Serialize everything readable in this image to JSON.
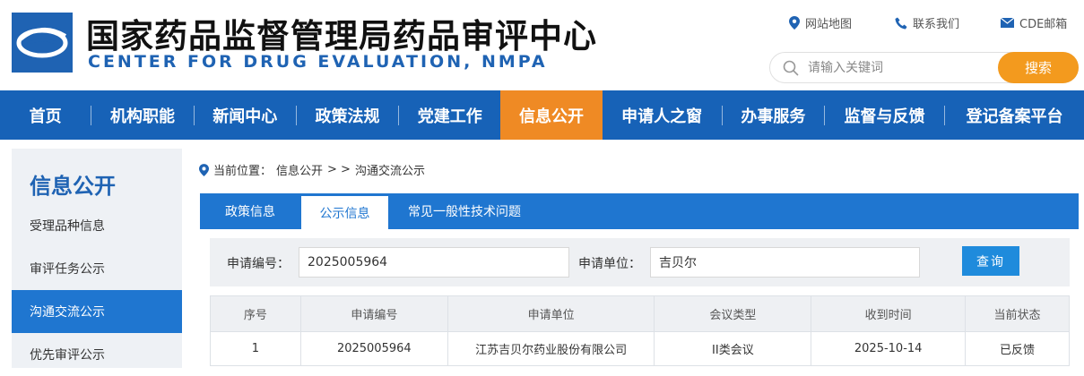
{
  "header": {
    "cn_title": "国家药品监督管理局药品审评中心",
    "en_title": "CENTER FOR DRUG EVALUATION, NMPA",
    "links": [
      {
        "label": "网站地图",
        "icon": "map-pin-icon"
      },
      {
        "label": "联系我们",
        "icon": "phone-icon"
      },
      {
        "label": "CDE邮箱",
        "icon": "mail-icon"
      }
    ],
    "search_placeholder": "请输入关键词",
    "search_button": "搜索"
  },
  "nav": {
    "items": [
      "首页",
      "机构职能",
      "新闻中心",
      "政策法规",
      "党建工作",
      "信息公开",
      "申请人之窗",
      "办事服务",
      "监督与反馈",
      "登记备案平台"
    ],
    "active": "信息公开"
  },
  "sidebar": {
    "title": "信息公开",
    "items": [
      "受理品种信息",
      "审评任务公示",
      "沟通交流公示",
      "优先审评公示"
    ],
    "active": "沟通交流公示"
  },
  "breadcrumb": {
    "prefix": "当前位置：",
    "path": "信息公开",
    "sep": "> >",
    "current": "沟通交流公示"
  },
  "tabs": {
    "items": [
      "政策信息",
      "公示信息",
      "常见一般性技术问题"
    ],
    "active": "公示信息"
  },
  "filter": {
    "app_no_label": "申请编号：",
    "app_no_value": "2025005964",
    "unit_label": "申请单位：",
    "unit_value": "吉贝尔",
    "query_button": "查询"
  },
  "table": {
    "headers": [
      "序号",
      "申请编号",
      "申请单位",
      "会议类型",
      "收到时间",
      "当前状态"
    ],
    "rows": [
      [
        "1",
        "2025005964",
        "江苏吉贝尔药业股份有限公司",
        "II类会议",
        "2025-10-14",
        "已反馈"
      ]
    ]
  },
  "colors": {
    "primary": "#1762b7",
    "accent": "#ef8a24",
    "sidebar_active": "#1f76d0"
  }
}
